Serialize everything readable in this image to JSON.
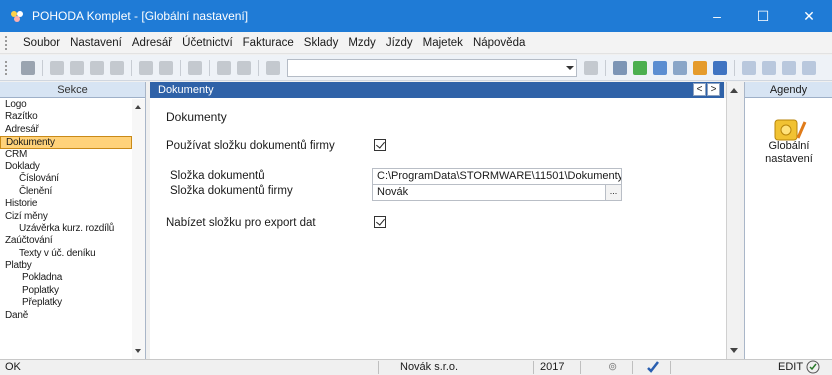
{
  "window": {
    "title": "POHODA Komplet - [Globální nastavení]",
    "controls": {
      "minimize": "–",
      "maximize": "☐",
      "close": "✕"
    }
  },
  "menu": [
    "Soubor",
    "Nastavení",
    "Adresář",
    "Účetnictví",
    "Fakturace",
    "Sklady",
    "Mzdy",
    "Jízdy",
    "Majetek",
    "Nápověda"
  ],
  "sidebar": {
    "header": "Sekce",
    "items": [
      {
        "label": "Logo",
        "level": 1
      },
      {
        "label": "Razítko",
        "level": 1
      },
      {
        "label": "Adresář",
        "level": 1
      },
      {
        "label": "Dokumenty",
        "level": 1,
        "selected": true
      },
      {
        "label": "CRM",
        "level": 1
      },
      {
        "label": "Doklady",
        "level": 1
      },
      {
        "label": "Číslování",
        "level": 2
      },
      {
        "label": "Členění",
        "level": 2
      },
      {
        "label": "Historie",
        "level": 1
      },
      {
        "label": "Cizí měny",
        "level": 1
      },
      {
        "label": "Uzávěrka kurz. rozdílů",
        "level": 2
      },
      {
        "label": "Zaúčtování",
        "level": 1
      },
      {
        "label": "Texty v úč. deníku",
        "level": 2
      },
      {
        "label": "Platby",
        "level": 1
      },
      {
        "label": "Pokladna",
        "level": 3
      },
      {
        "label": "Poplatky",
        "level": 3
      },
      {
        "label": "Přeplatky",
        "level": 3
      },
      {
        "label": "Daně",
        "level": 1
      }
    ]
  },
  "document": {
    "header": "Dokumenty",
    "nav_prev": "<",
    "nav_next": ">",
    "form_title": "Dokumenty",
    "use_company_folder_label": "Používat složku dokumentů firmy",
    "use_company_folder_checked": true,
    "folder_label": "Složka dokumentů",
    "folder_value": "C:\\ProgramData\\STORMWARE\\11501\\Dokumenty\\",
    "company_folder_label": "Složka dokumentů firmy",
    "company_folder_value": "Novák",
    "browse_label": "...",
    "export_folder_label": "Nabízet složku pro export dat",
    "export_folder_checked": true
  },
  "agendy": {
    "header": "Agendy",
    "item_label": "Globální nastavení",
    "item_icon": "global-settings-icon"
  },
  "status": {
    "left": "OK",
    "company": "Novák s.r.o.",
    "year": "2017",
    "mode": "EDIT"
  },
  "colors": {
    "titlebar": "#1f7bd6",
    "doc_header": "#2f62a8",
    "selection": "#ffd27a"
  }
}
